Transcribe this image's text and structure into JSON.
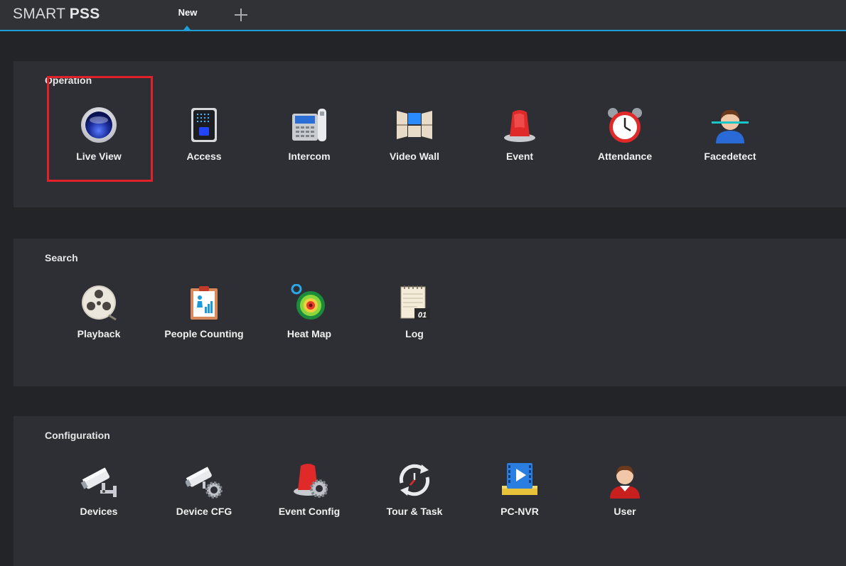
{
  "app": {
    "brand_light": "SMART ",
    "brand_bold": "PSS"
  },
  "tabs": {
    "active_label": "New",
    "add_icon": "plus-icon"
  },
  "colors": {
    "accent": "#1f9ed8",
    "highlight": "#e0212a",
    "panel": "#2d2f34",
    "background": "#222428"
  },
  "sections": {
    "operation": {
      "title": "Operation",
      "items": [
        {
          "label": "Live View",
          "icon": "camera-lens-icon"
        },
        {
          "label": "Access",
          "icon": "access-terminal-icon"
        },
        {
          "label": "Intercom",
          "icon": "intercom-phone-icon"
        },
        {
          "label": "Video Wall",
          "icon": "video-wall-icon"
        },
        {
          "label": "Event",
          "icon": "alarm-siren-icon"
        },
        {
          "label": "Attendance",
          "icon": "alarm-clock-icon"
        },
        {
          "label": "Facedetect",
          "icon": "face-scan-icon"
        }
      ]
    },
    "search": {
      "title": "Search",
      "items": [
        {
          "label": "Playback",
          "icon": "film-reel-icon"
        },
        {
          "label": "People Counting",
          "icon": "people-counting-icon"
        },
        {
          "label": "Heat Map",
          "icon": "heat-map-icon"
        },
        {
          "label": "Log",
          "icon": "log-notepad-icon"
        }
      ]
    },
    "configuration": {
      "title": "Configuration",
      "items": [
        {
          "label": "Devices",
          "icon": "cctv-camera-icon"
        },
        {
          "label": "Device CFG",
          "icon": "camera-gear-icon"
        },
        {
          "label": "Event Config",
          "icon": "siren-gear-icon"
        },
        {
          "label": "Tour & Task",
          "icon": "tour-clock-icon"
        },
        {
          "label": "PC-NVR",
          "icon": "pc-nvr-icon"
        },
        {
          "label": "User",
          "icon": "user-icon"
        }
      ]
    }
  },
  "log_icon_text": "01"
}
